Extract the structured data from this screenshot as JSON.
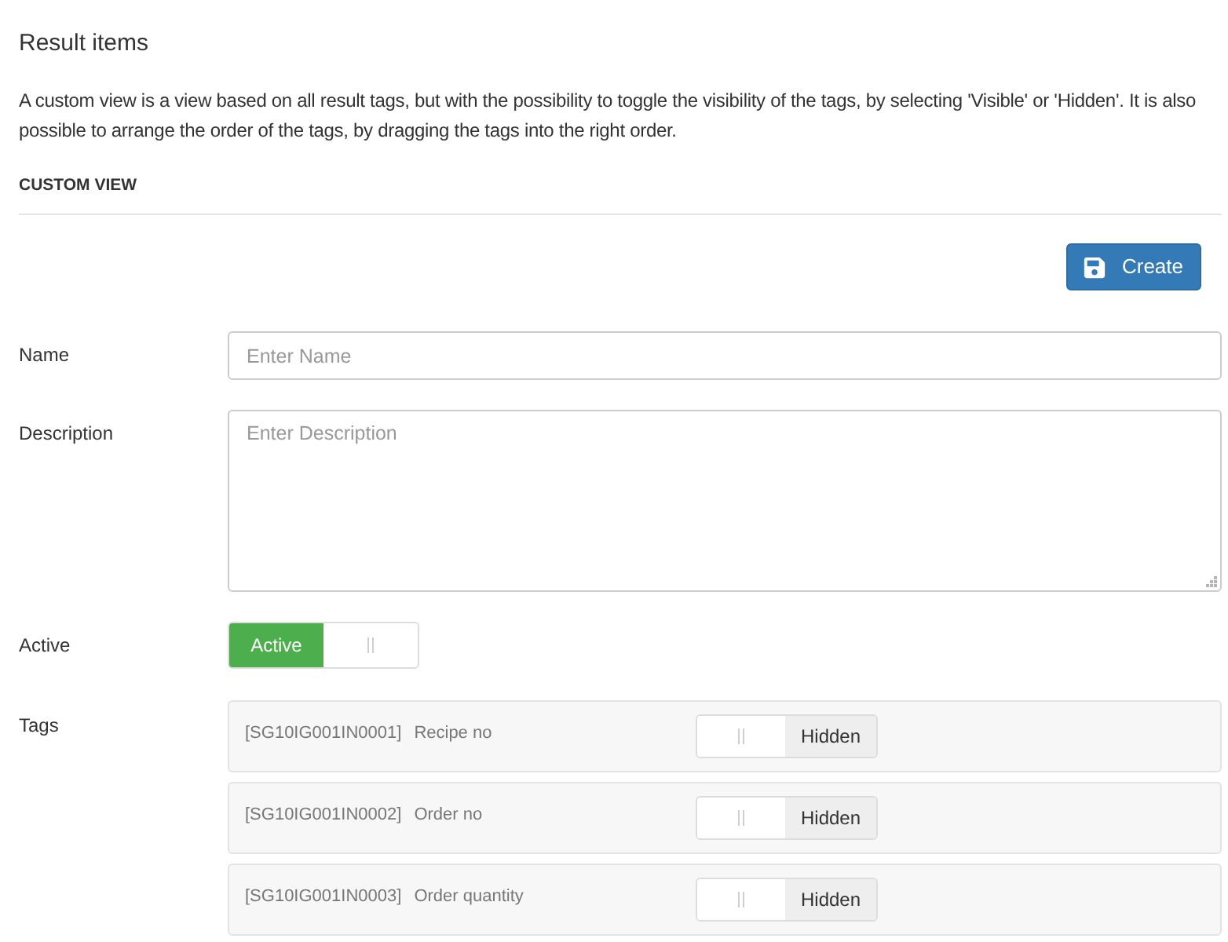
{
  "heading": "Result items",
  "description": "A custom view is a view based on all result tags, but with the possibility to toggle the visibility of the tags, by selecting 'Visible' or 'Hidden'. It is also possible to arrange the order of the tags, by dragging the tags into the right order.",
  "section_title": "CUSTOM VIEW",
  "create_button": {
    "label": "Create"
  },
  "fields": [
    {
      "kind": "text",
      "label": "Name",
      "placeholder": "Enter Name"
    },
    {
      "kind": "textarea",
      "label": "Description",
      "placeholder": "Enter Description"
    },
    {
      "kind": "switch",
      "label": "Active",
      "switch": {
        "on": true,
        "label": "Active"
      }
    }
  ],
  "tags": {
    "label": "Tags",
    "items": [
      {
        "code": "[SG10IG001IN0001]",
        "name": "Recipe no",
        "switch": {
          "on": false,
          "label": "Hidden"
        }
      },
      {
        "code": "[SG10IG001IN0002]",
        "name": "Order no",
        "switch": {
          "on": false,
          "label": "Hidden"
        }
      },
      {
        "code": "[SG10IG001IN0003]",
        "name": "Order quantity",
        "switch": {
          "on": false,
          "label": "Hidden"
        }
      }
    ]
  }
}
